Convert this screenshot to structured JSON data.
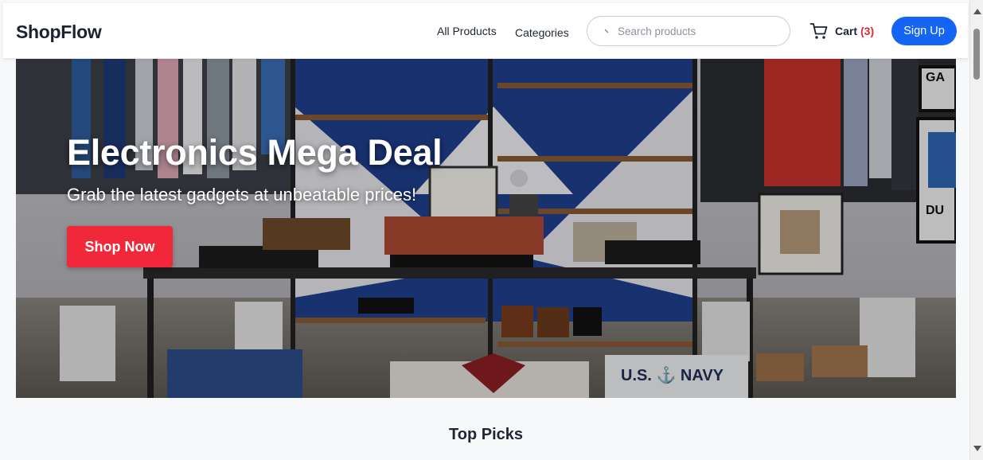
{
  "header": {
    "logo": "ShopFlow",
    "nav": [
      {
        "label": "All Products"
      },
      {
        "label": "Categories"
      }
    ],
    "search": {
      "placeholder": "Search products",
      "value": ""
    },
    "cart": {
      "label": "Cart",
      "count": "(3)",
      "icon": "cart-icon"
    },
    "signup_label": "Sign Up"
  },
  "hero": {
    "title": "Electronics Mega Deal",
    "subtitle": "Grab the latest gadgets at unbeatable prices!",
    "cta_label": "Shop Now",
    "image": "clothing-store-interior",
    "shirt_text": "U.S. ⚓ NAVY",
    "sign_text_1": "GA",
    "sign_text_2": "DU"
  },
  "sections": {
    "top_picks_title": "Top Picks"
  },
  "colors": {
    "primary": "#1565f5",
    "cta": "#f0283a",
    "cart_count": "#e0263a"
  }
}
